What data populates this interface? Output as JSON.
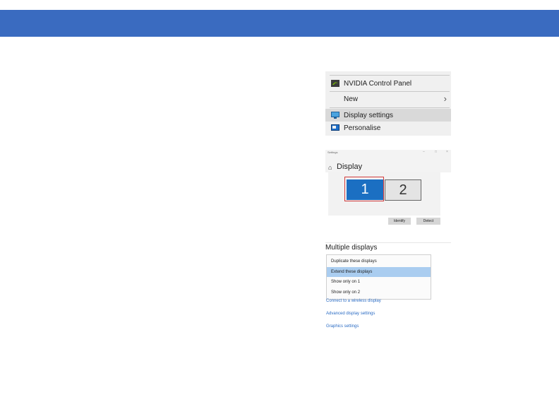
{
  "context_menu": {
    "items": [
      {
        "label": "NVIDIA Control Panel",
        "icon": "nvidia-icon"
      },
      {
        "label": "New",
        "icon": "chevron-right-icon"
      },
      {
        "label": "Display settings",
        "icon": "display-settings-icon"
      },
      {
        "label": "Personalise",
        "icon": "personalise-icon"
      }
    ],
    "highlighted": "Display settings"
  },
  "settings": {
    "window_title": "Settings",
    "page_title": "Display",
    "monitors": [
      {
        "label": "1",
        "selected": true
      },
      {
        "label": "2",
        "selected": false
      }
    ],
    "identify_label": "Identify",
    "detect_label": "Detect",
    "selected_color": "#1b6fc2",
    "highlight_frame_color": "#d23b3b"
  },
  "multiple_displays": {
    "title": "Multiple displays",
    "options": [
      "Duplicate these displays",
      "Extend these displays",
      "Show only on 1",
      "Show only on 2"
    ],
    "selected": "Extend these displays",
    "links": [
      "Connect to a wireless display",
      "Advanced display settings",
      "Graphics settings"
    ]
  },
  "colors": {
    "top_bar": "#3a6bc0",
    "link": "#2b6cc4",
    "selected_option": "#aacdf0"
  }
}
